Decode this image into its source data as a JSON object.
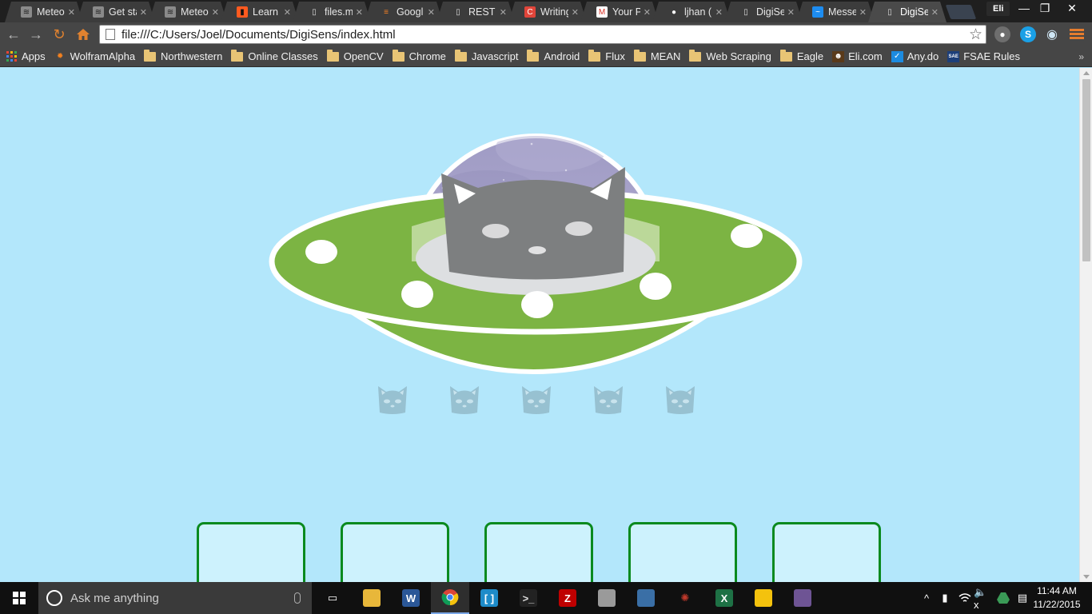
{
  "browser": {
    "tabs": [
      {
        "label": "Meteo",
        "icon": "meteor-icon",
        "active": false
      },
      {
        "label": "Get sta",
        "icon": "meteor-icon",
        "active": false
      },
      {
        "label": "Meteo",
        "icon": "meteor-icon",
        "active": false
      },
      {
        "label": "Learn I",
        "icon": "learn-icon",
        "active": false
      },
      {
        "label": "files.m",
        "icon": "page-icon",
        "active": false
      },
      {
        "label": "Googl",
        "icon": "stackoverflow-icon",
        "active": false
      },
      {
        "label": "REST A",
        "icon": "page-icon",
        "active": false
      },
      {
        "label": "Writing",
        "icon": "c-icon",
        "active": false
      },
      {
        "label": "Your P",
        "icon": "gmail-icon",
        "active": false
      },
      {
        "label": "ljhan (",
        "icon": "github-icon",
        "active": false
      },
      {
        "label": "DigiSe",
        "icon": "page-icon",
        "active": false
      },
      {
        "label": "Messe",
        "icon": "messenger-icon",
        "active": false
      },
      {
        "label": "DigiSe",
        "icon": "page-icon",
        "active": true
      }
    ],
    "profile_name": "Eli",
    "window_controls": {
      "minimize": "—",
      "restore": "❐",
      "close": "✕"
    },
    "address_bar": {
      "url": "file:///C:/Users/Joel/Documents/DigiSens/index.html"
    },
    "bookmarks": [
      {
        "label": "Apps",
        "type": "apps"
      },
      {
        "label": "WolframAlpha",
        "type": "wolfram"
      },
      {
        "label": "Northwestern",
        "type": "folder"
      },
      {
        "label": "Online Classes",
        "type": "folder"
      },
      {
        "label": "OpenCV",
        "type": "folder"
      },
      {
        "label": "Chrome",
        "type": "folder"
      },
      {
        "label": "Javascript",
        "type": "folder"
      },
      {
        "label": "Android",
        "type": "folder"
      },
      {
        "label": "Flux",
        "type": "folder"
      },
      {
        "label": "MEAN",
        "type": "folder"
      },
      {
        "label": "Web Scraping",
        "type": "folder"
      },
      {
        "label": "Eagle",
        "type": "folder"
      },
      {
        "label": "Eli.com",
        "type": "eli"
      },
      {
        "label": "Any.do",
        "type": "anydo"
      },
      {
        "label": "FSAE Rules",
        "type": "fsae"
      }
    ],
    "bookmarks_overflow": "»"
  },
  "page": {
    "cat_count": 5,
    "slot_count": 5,
    "colors": {
      "background": "#b3e7fb",
      "ufo_green": "#7cb443",
      "ufo_outline": "#ffffff",
      "dome_purple": "#a39fc6",
      "cat_gray": "#7d7f80",
      "slot_border": "#0a8a1e"
    }
  },
  "taskbar": {
    "search_placeholder": "Ask me anything",
    "apps": [
      {
        "name": "task-view",
        "label": ""
      },
      {
        "name": "file-explorer",
        "label": ""
      },
      {
        "name": "word",
        "label": "W"
      },
      {
        "name": "chrome",
        "label": ""
      },
      {
        "name": "brackets",
        "label": "[ ]"
      },
      {
        "name": "command-prompt",
        "label": ">_"
      },
      {
        "name": "filezilla",
        "label": "Z"
      },
      {
        "name": "window",
        "label": ""
      },
      {
        "name": "python",
        "label": ""
      },
      {
        "name": "spider",
        "label": ""
      },
      {
        "name": "excel",
        "label": "X"
      },
      {
        "name": "drive",
        "label": ""
      },
      {
        "name": "github",
        "label": ""
      }
    ],
    "tray_up": "^",
    "clock_time": "11:44 AM",
    "clock_date": "11/22/2015"
  }
}
